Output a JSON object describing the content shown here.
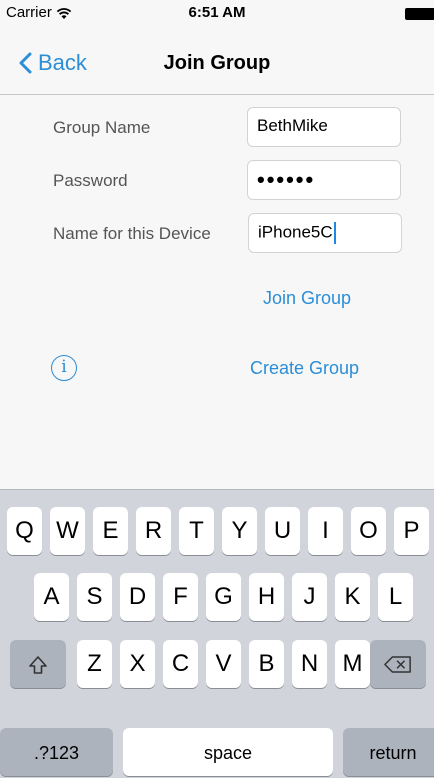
{
  "status_bar": {
    "carrier": "Carrier",
    "time": "6:51 AM"
  },
  "nav": {
    "back_label": "Back",
    "title": "Join Group"
  },
  "form": {
    "group_name_label": "Group Name",
    "group_name_value": "BethMike",
    "password_label": "Password",
    "password_value": "••••••",
    "device_label": "Name for this Device",
    "device_value": "iPhone5C"
  },
  "actions": {
    "join_label": "Join Group",
    "create_label": "Create Group",
    "info_symbol": "i"
  },
  "keyboard": {
    "row1": [
      "Q",
      "W",
      "E",
      "R",
      "T",
      "Y",
      "U",
      "I",
      "O",
      "P"
    ],
    "row2": [
      "A",
      "S",
      "D",
      "F",
      "G",
      "H",
      "J",
      "K",
      "L"
    ],
    "row3": [
      "Z",
      "X",
      "C",
      "V",
      "B",
      "N",
      "M"
    ],
    "shift_symbol": "⇧",
    "delete_symbol": "⌫",
    "numbers_label": ".?123",
    "space_label": "space",
    "return_label": "return"
  },
  "icons": {
    "back": "chevron-left-icon",
    "wifi": "wifi-icon",
    "battery": "battery-icon",
    "info": "info-icon"
  },
  "colors": {
    "accent": "#2b8ed6",
    "background": "#f7f7f7",
    "keyboard": "#d1d5db"
  }
}
